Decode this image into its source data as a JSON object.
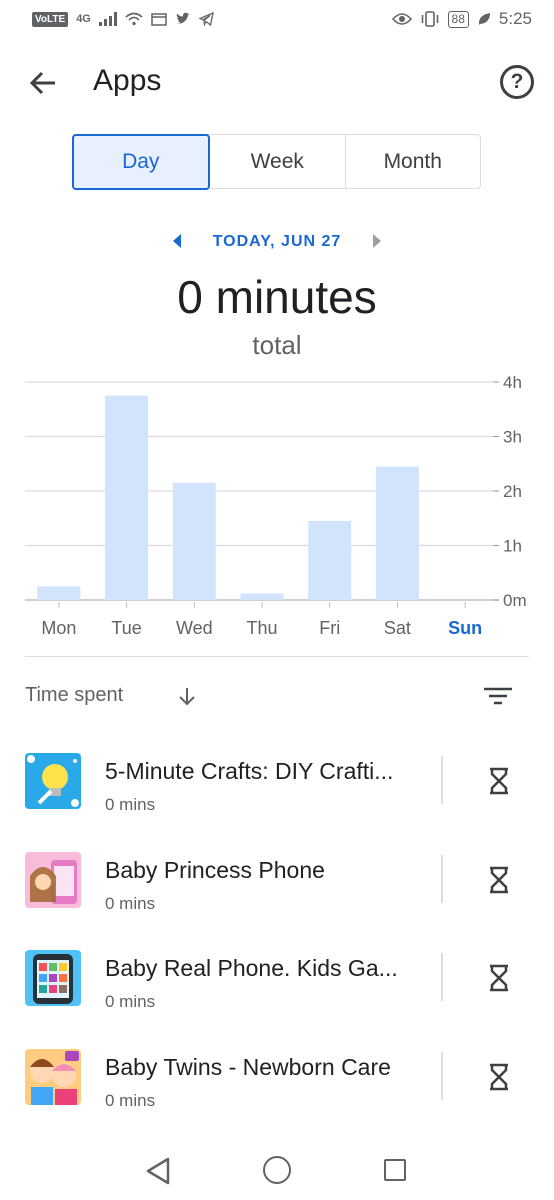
{
  "status_bar": {
    "volte": "VoLTE",
    "network": "4G",
    "battery": "88",
    "time": "5:25"
  },
  "app_bar": {
    "title": "Apps",
    "back_icon": "arrow-back-icon",
    "help_icon": "help-icon",
    "help_glyph": "?"
  },
  "tabs": [
    {
      "label": "Day",
      "active": true
    },
    {
      "label": "Week",
      "active": false
    },
    {
      "label": "Month",
      "active": false
    }
  ],
  "date_nav": {
    "label": "TODAY, JUN 27",
    "prev_icon": "triangle-left-icon",
    "next_icon": "triangle-right-icon"
  },
  "total": {
    "value": "0 minutes",
    "label": "total"
  },
  "chart_data": {
    "type": "bar",
    "categories": [
      "Mon",
      "Tue",
      "Wed",
      "Thu",
      "Fri",
      "Sat",
      "Sun"
    ],
    "values": [
      0.25,
      3.75,
      2.15,
      0.12,
      1.45,
      2.45,
      0
    ],
    "unit": "hours",
    "y_ticks": [
      "0m",
      "1h",
      "2h",
      "3h",
      "4h"
    ],
    "ylim": [
      0,
      4
    ],
    "highlight_category": "Sun",
    "bar_color": "#d2e3fc",
    "highlight_color": "#1967d2",
    "grid": true,
    "y_axis_side": "right"
  },
  "sort": {
    "label": "Time spent",
    "arrow_icon": "arrow-down-icon",
    "filter_icon": "filter-list-icon"
  },
  "apps": [
    {
      "name": "5-Minute Crafts: DIY Crafti...",
      "time": "0 mins",
      "icon": "crafts-lightbulb-icon"
    },
    {
      "name": "Baby Princess Phone",
      "time": "0 mins",
      "icon": "baby-princess-phone-icon"
    },
    {
      "name": "Baby Real Phone. Kids Ga...",
      "time": "0 mins",
      "icon": "baby-real-phone-icon"
    },
    {
      "name": "Baby Twins - Newborn Care",
      "time": "0 mins",
      "icon": "baby-twins-icon"
    }
  ],
  "timer_icon": "hourglass-icon",
  "nav_bar": {
    "back_icon": "nav-back-icon",
    "home_icon": "nav-home-icon",
    "recents_icon": "nav-recents-icon"
  },
  "colors": {
    "accent": "#1967d2",
    "accent_bg": "#e8f0fe",
    "text_primary": "#202124",
    "text_secondary": "#5f6368",
    "divider": "#dadce0"
  }
}
